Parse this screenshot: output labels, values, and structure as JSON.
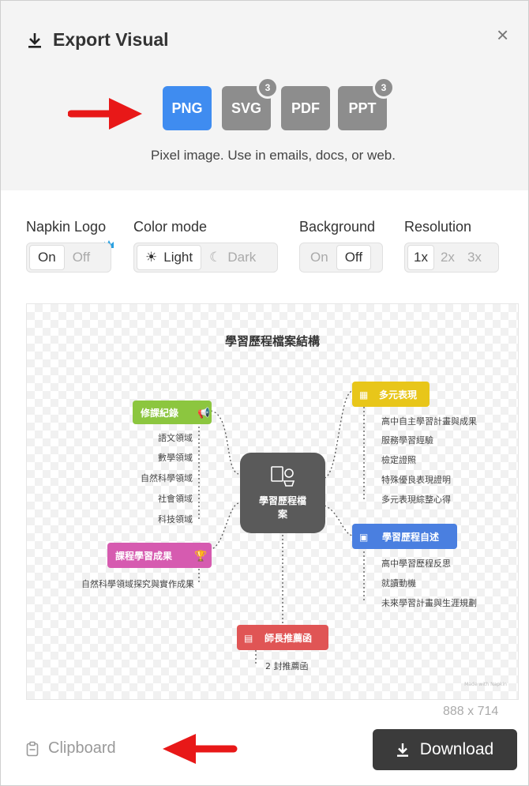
{
  "dialog": {
    "title": "Export Visual",
    "close_label": "×"
  },
  "formats": [
    {
      "label": "PNG",
      "badge": ""
    },
    {
      "label": "SVG",
      "badge": "3"
    },
    {
      "label": "PDF",
      "badge": ""
    },
    {
      "label": "PPT",
      "badge": "3"
    }
  ],
  "format_description": "Pixel image. Use in emails, docs, or web.",
  "options": {
    "napkin_logo": {
      "label": "Napkin Logo",
      "on": "On",
      "off": "Off"
    },
    "color_mode": {
      "label": "Color mode",
      "light": "Light",
      "dark": "Dark"
    },
    "background": {
      "label": "Background",
      "on": "On",
      "off": "Off"
    },
    "resolution": {
      "label": "Resolution",
      "r1": "1x",
      "r2": "2x",
      "r3": "3x"
    }
  },
  "mindmap": {
    "title": "學習歷程檔案結構",
    "center": [
      "學習歷程檔",
      "案"
    ],
    "left_top": {
      "label": "修課紀錄",
      "items": [
        "語文領域",
        "數學領域",
        "自然科學領域",
        "社會領域",
        "科技領域"
      ]
    },
    "left_bottom": {
      "label": "課程學習成果",
      "items": [
        "自然科學領域探究與實作成果"
      ]
    },
    "right_top": {
      "label": "多元表現",
      "items": [
        "高中自主學習計畫與成果",
        "服務學習經驗",
        "檢定證照",
        "特殊優良表現證明",
        "多元表現綜整心得"
      ]
    },
    "right_mid": {
      "label": "學習歷程自述",
      "items": [
        "高中學習歷程反思",
        "就讀動機",
        "未來學習計畫與生涯規劃"
      ]
    },
    "bottom": {
      "label": "師長推薦函",
      "items": [
        "2 封推薦函"
      ]
    },
    "watermark": "Made with Napkin"
  },
  "dimensions": "888 x 714",
  "clipboard_label": "Clipboard",
  "download_label": "Download",
  "colors": {
    "accent": "#3f8cf0",
    "green": "#8cc63f",
    "pink": "#d65bb0",
    "yellow": "#e8c61a",
    "blue": "#4a7fe0",
    "red": "#e05555",
    "center": "#5a5a5a",
    "arrow": "#e81818"
  }
}
